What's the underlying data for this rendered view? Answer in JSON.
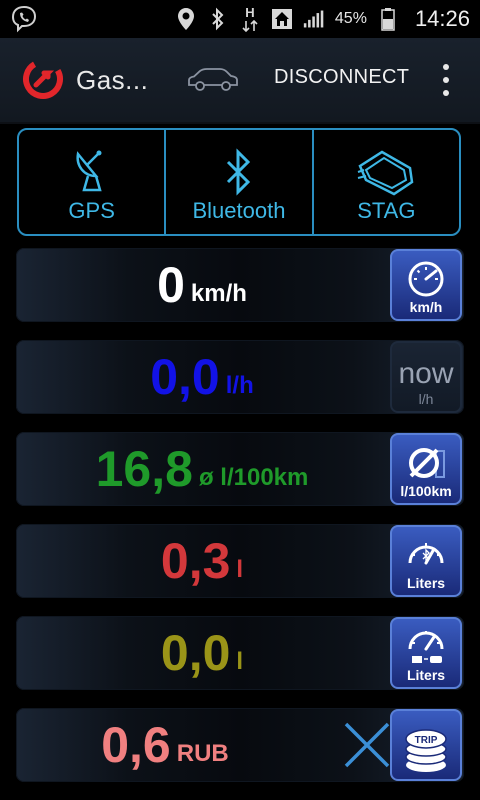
{
  "status_bar": {
    "left_icon": "viber-icon",
    "battery_percent": "45%",
    "time": "14:26",
    "network_type": "H",
    "icons": [
      "location-icon",
      "bluetooth-icon",
      "h-network-icon",
      "home-icon",
      "signal-icon",
      "battery-icon"
    ]
  },
  "app_bar": {
    "title": "Gas...",
    "disconnect_label": "DISCONNECT",
    "logo_color": "#e2262b"
  },
  "tabs": [
    {
      "label": "GPS",
      "icon": "satellite-dish-icon"
    },
    {
      "label": "Bluetooth",
      "icon": "bluetooth-icon"
    },
    {
      "label": "STAG",
      "icon": "stag-device-icon"
    }
  ],
  "metrics": [
    {
      "value": "0",
      "unit": "km/h",
      "color": "#ffffff",
      "button_label": "km/h",
      "button_icon": "speedometer-icon"
    },
    {
      "value": "0,0",
      "unit": "l/h",
      "color": "#1212e6",
      "button_label": "l/h",
      "button_top_text": "now",
      "button_icon": "fuel-now-icon"
    },
    {
      "value": "16,8",
      "unit": "ø l/100km",
      "color": "#1f9a2a",
      "button_label": "l/100km",
      "button_icon": "average-consumption-icon"
    },
    {
      "value": "0,3",
      "unit": "l",
      "color": "#d3383b",
      "button_label": "Liters",
      "button_icon": "gauge-bluetooth-icon"
    },
    {
      "value": "0,0",
      "unit": "l",
      "color": "#9a9418",
      "button_label": "Liters",
      "button_icon": "gauge-cars-icon"
    },
    {
      "value": "0,6",
      "unit": "RUB",
      "color": "#f08080",
      "button_label": "TRIP",
      "button_icon": "trip-coins-icon"
    }
  ],
  "colors": {
    "accent_blue": "#2a8ec0",
    "tab_text": "#3fb8e6"
  }
}
